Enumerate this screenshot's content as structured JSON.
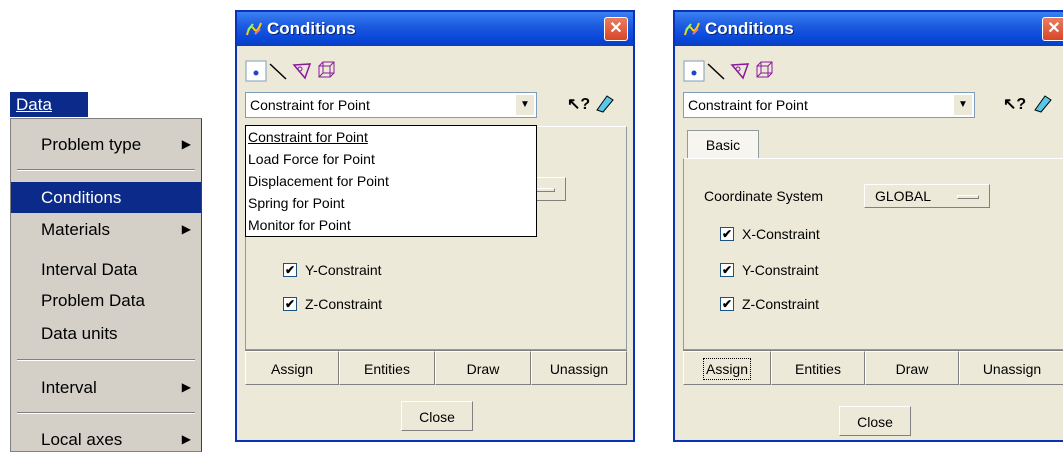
{
  "data_menu": {
    "title": "Data",
    "items": [
      {
        "label": "Problem type",
        "submenu": true
      },
      {
        "label": "Conditions",
        "submenu": false,
        "selected": true
      },
      {
        "label": "Materials",
        "submenu": true
      },
      {
        "label": "Interval Data",
        "submenu": false
      },
      {
        "label": "Problem Data",
        "submenu": false
      },
      {
        "label": "Data units",
        "submenu": false
      },
      {
        "label": "Interval",
        "submenu": true
      },
      {
        "label": "Local axes",
        "submenu": true
      }
    ]
  },
  "window1": {
    "title": "Conditions",
    "close_glyph": "✕",
    "combo_value": "Constraint for Point",
    "dropdown_options": [
      "Constraint for Point",
      "Load Force for Point",
      "Displacement for Point",
      "Spring for Point",
      "Monitor for Point"
    ],
    "checkboxes": [
      {
        "label": "Y-Constraint",
        "checked": true
      },
      {
        "label": "Z-Constraint",
        "checked": true
      }
    ],
    "buttons": [
      "Assign",
      "Entities",
      "Draw",
      "Unassign"
    ],
    "close_label": "Close"
  },
  "window2": {
    "title": "Conditions",
    "close_glyph": "✕",
    "combo_value": "Constraint for Point",
    "tab_label": "Basic",
    "coordinate_label": "Coordinate System",
    "coordinate_value": "GLOBAL",
    "checkboxes": [
      {
        "label": "X-Constraint",
        "checked": true
      },
      {
        "label": "Y-Constraint",
        "checked": true
      },
      {
        "label": "Z-Constraint",
        "checked": true
      }
    ],
    "buttons": [
      "Assign",
      "Entities",
      "Draw",
      "Unassign"
    ],
    "close_label": "Close"
  },
  "check_glyph": "✔",
  "arrow_glyph": "▶",
  "drop_glyph": "▼",
  "help_glyph": "↖?",
  "colors": {
    "menu_highlight": "#0b2a8a",
    "titlebar": "#0846d8",
    "close_button": "#d9452a"
  }
}
